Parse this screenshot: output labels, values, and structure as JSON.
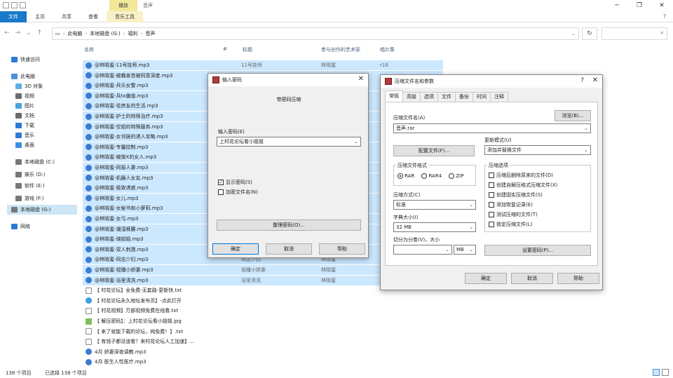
{
  "ribbon": {
    "context_tab": "播放",
    "window_title": "音声",
    "tabs": [
      "文件",
      "主页",
      "共享",
      "查看",
      "音乐工具"
    ]
  },
  "address": {
    "crumbs": [
      "此电脑",
      "本地磁盘 (G:)",
      "福利",
      "音声"
    ]
  },
  "sidebar": {
    "items": [
      {
        "label": "快速访问",
        "color": "#2a7bd6"
      },
      {
        "label": "此电脑",
        "color": "#4a90d9"
      },
      {
        "label": "3D 对象",
        "color": "#5ab0e8"
      },
      {
        "label": "视频",
        "color": "#6b6b6b"
      },
      {
        "label": "图片",
        "color": "#4aa3df"
      },
      {
        "label": "文档",
        "color": "#6b6b6b"
      },
      {
        "label": "下载",
        "color": "#2a7bd6"
      },
      {
        "label": "音乐",
        "color": "#2a7bd6"
      },
      {
        "label": "桌面",
        "color": "#3a8ee6"
      },
      {
        "label": "本地磁盘 (C:)",
        "color": "#777"
      },
      {
        "label": "娱乐 (D:)",
        "color": "#777"
      },
      {
        "label": "软件 (E:)",
        "color": "#777"
      },
      {
        "label": "游戏 (F:)",
        "color": "#777"
      },
      {
        "label": "本地磁盘 (G:)",
        "color": "#777"
      },
      {
        "label": "网络",
        "color": "#2a7bd6"
      }
    ]
  },
  "columns": {
    "name": "名称",
    "num": "#",
    "title": "标题",
    "artist": "参与创作的艺术家",
    "album": "唱片集"
  },
  "files": [
    {
      "name": "@林晓蜜-11号技师.mp3",
      "title": "11号技师",
      "artist": "林晓蜜",
      "album": "r18"
    },
    {
      "name": "@林晓蜜-被趣善皆被同意深度.mp3"
    },
    {
      "name": "@林晓蜜-兵乐女警.mp3"
    },
    {
      "name": "@林晓蜜-兵tx偏值.mp3"
    },
    {
      "name": "@林晓蜜-花房友的生活.mp3"
    },
    {
      "name": "@林晓蜜-护士的特殊治疗.mp3"
    },
    {
      "name": "@林晓蜜-空姐的特殊服务.mp3"
    },
    {
      "name": "@林晓蜜-女邻居的诱人攻略.mp3"
    },
    {
      "name": "@林晓蜜-专屬控制.mp3"
    },
    {
      "name": "@林晓蜜-被按X的女人.mp3"
    },
    {
      "name": "@林晓蜜-同窗人妻.mp3"
    },
    {
      "name": "@林晓蜜-机器人女友.mp3"
    },
    {
      "name": "@林晓蜜-极致诱惑.mp3"
    },
    {
      "name": "@林晓蜜-女儿.mp3"
    },
    {
      "name": "@林晓蜜-女秘书和小萝莉.mp3"
    },
    {
      "name": "@林晓蜜-女弓.mp3"
    },
    {
      "name": "@林晓蜜-潮湿裤腰.mp3"
    },
    {
      "name": "@林晓蜜-骑姐姐.mp3"
    },
    {
      "name": "@林晓蜜-双人刺激.mp3"
    },
    {
      "name": "@林晓蜜-同志少妇.mp3",
      "title": "同志少妇",
      "artist": "林晓蜜"
    },
    {
      "name": "@林晓蜜-视播小娇妻.mp3",
      "title": "视播小娇妻",
      "artist": "林晓蜜"
    },
    {
      "name": "@林晓蜜-浴室清洗.mp3",
      "title": "浴室清洗",
      "artist": "林晓蜜"
    },
    {
      "name": "【 村花论坛】全免费-无套路-更新快.txt",
      "type": "doc"
    },
    {
      "name": "【 村花论坛永久地址发布页】-点此打开",
      "type": "web"
    },
    {
      "name": "【 村花视频】万部视频免费在线看.txt",
      "type": "doc"
    },
    {
      "name": "【 解压密码】：上村花论坛看小姐姐.jpg",
      "type": "img"
    },
    {
      "name": "【 来了就能下载的论坛，纯免费！】.txt",
      "type": "doc"
    },
    {
      "name": "【 有钱子都没道看？来村花论坛人工加速】...",
      "type": "doc"
    },
    {
      "name": "4月 娇妻深夜调教.mp3"
    },
    {
      "name": "4月 医生人性医疗.mp3"
    }
  ],
  "status": {
    "count": "138 个项目",
    "selected": "已选择 138 个项目"
  },
  "pwd_dialog": {
    "title": "输入密码",
    "heading": "带密码压缩",
    "input_label": "输入密码(E)",
    "password": "上村花论坛看小姐姐",
    "cb_show": "显示密码(S)",
    "cb_encrypt": "加密文件名(N)",
    "organize": "整理密码(O)...",
    "ok": "确定",
    "cancel": "取消",
    "help": "帮助"
  },
  "archive_dialog": {
    "title": "压缩文件名和参数",
    "tabs": [
      "常规",
      "高级",
      "选项",
      "文件",
      "备份",
      "时间",
      "注释"
    ],
    "name_label": "压缩文件名(A)",
    "browse": "浏览(B)...",
    "name_value": "音声.rar",
    "update_label": "更新模式(U)",
    "update_value": "添加并替换文件",
    "profile": "配置文件(F)...",
    "format_label": "压缩文件格式",
    "formats": [
      "RAR",
      "RAR4",
      "ZIP"
    ],
    "method_label": "压缩方式(C)",
    "method_value": "标准",
    "dict_label": "字典大小(I)",
    "dict_value": "32 MB",
    "split_label": "切分为分卷(V)，大小",
    "split_unit": "MB",
    "options_label": "压缩选项",
    "options": [
      "压缩后删除原来的文件(D)",
      "创建自解压格式压缩文件(X)",
      "创建固实压缩文件(S)",
      "添加恢复记录(E)",
      "测试压缩的文件(T)",
      "锁定压缩文件(L)"
    ],
    "set_password": "设置密码(P)...",
    "ok": "确定",
    "cancel": "取消",
    "help": "帮助"
  }
}
